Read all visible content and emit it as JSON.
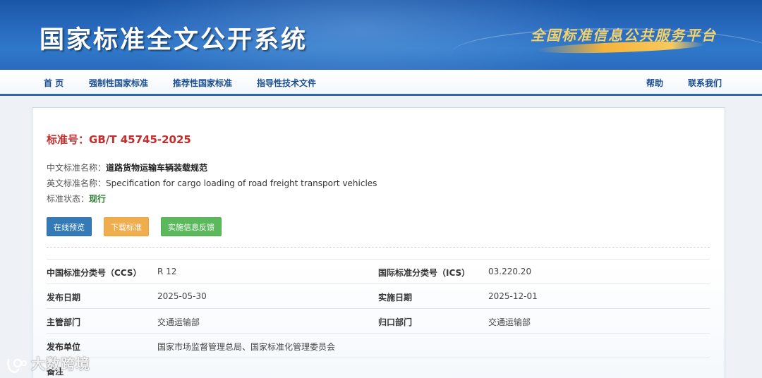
{
  "header": {
    "title": "国家标准全文公开系统",
    "slogan": "全国标准信息公共服务平台"
  },
  "nav": {
    "left": [
      "首 页",
      "强制性国家标准",
      "推荐性国家标准",
      "指导性技术文件"
    ],
    "right": [
      "帮助",
      "联系我们"
    ]
  },
  "standard": {
    "title_prefix": "标准号：",
    "number": "GB/T 45745-2025",
    "cn_name_label": "中文标准名称：",
    "cn_name": "道路货物运输车辆装载规范",
    "en_name_label": "英文标准名称：",
    "en_name": "Specification for cargo loading of road freight transport vehicles",
    "status_label": "标准状态：",
    "status": "现行"
  },
  "buttons": {
    "preview": "在线预览",
    "download": "下载标准",
    "feedback": "实施信息反馈"
  },
  "details": {
    "ccs_label": "中国标准分类号（CCS）",
    "ccs": "R 12",
    "ics_label": "国际标准分类号（ICS）",
    "ics": "03.220.20",
    "publish_label": "发布日期",
    "publish": "2025-05-30",
    "implement_label": "实施日期",
    "implement": "2025-12-01",
    "competent_label": "主管部门",
    "competent": "交通运输部",
    "centralized_label": "归口部门",
    "centralized": "交通运输部",
    "issuer_label": "发布单位",
    "issuer": "国家市场监督管理总局、国家标准化管理委员会",
    "remark_label": "备注"
  },
  "watermark": "大数跨境",
  "colors": {
    "title_red": "#c62c2c",
    "nav_blue": "#1b4f93",
    "status_green": "#2e7d32",
    "btn_blue": "#337ab7",
    "btn_orange": "#f0ad4e",
    "btn_green": "#5cb85c"
  }
}
